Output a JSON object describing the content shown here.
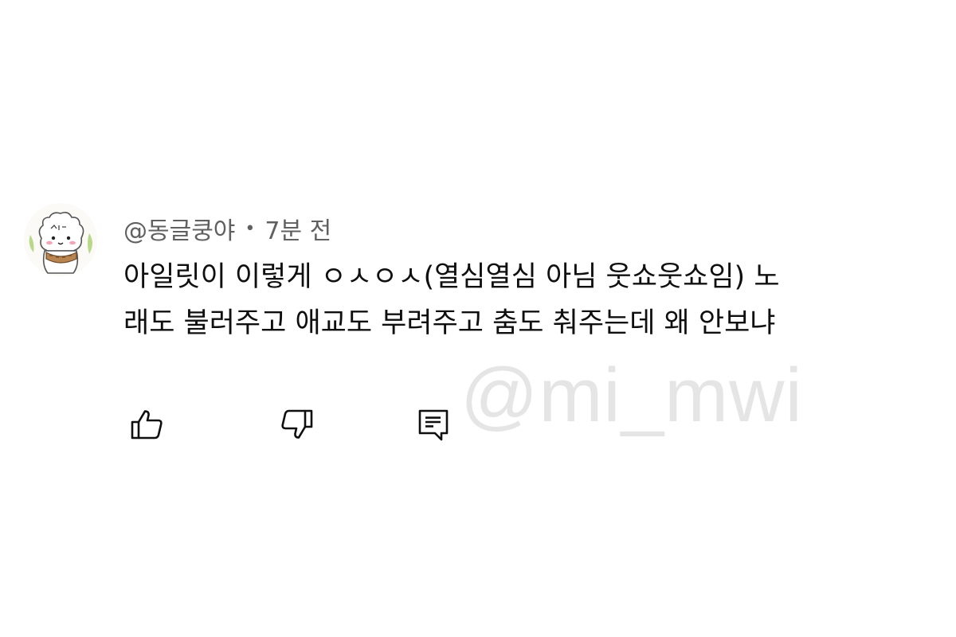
{
  "comment": {
    "author": "@동글쿵야",
    "separator": "•",
    "timestamp": "7분 전",
    "text_lines": [
      "아일릿이 이렇게 ㅇㅅㅇㅅ(열심열심 아님 웃쇼웃쇼임) 노",
      "래도 불러주고 애교도 부려주고 춤도 춰주는데 왜 안보냐"
    ],
    "actions": {
      "like_icon": "thumbs-up-icon",
      "dislike_icon": "thumbs-down-icon",
      "reply_icon": "reply-comment-icon"
    }
  },
  "watermark": "@mi_mwi",
  "colors": {
    "text": "#0f0f0f",
    "meta": "#606060",
    "watermark": "#e5e5e5",
    "background": "#ffffff"
  }
}
